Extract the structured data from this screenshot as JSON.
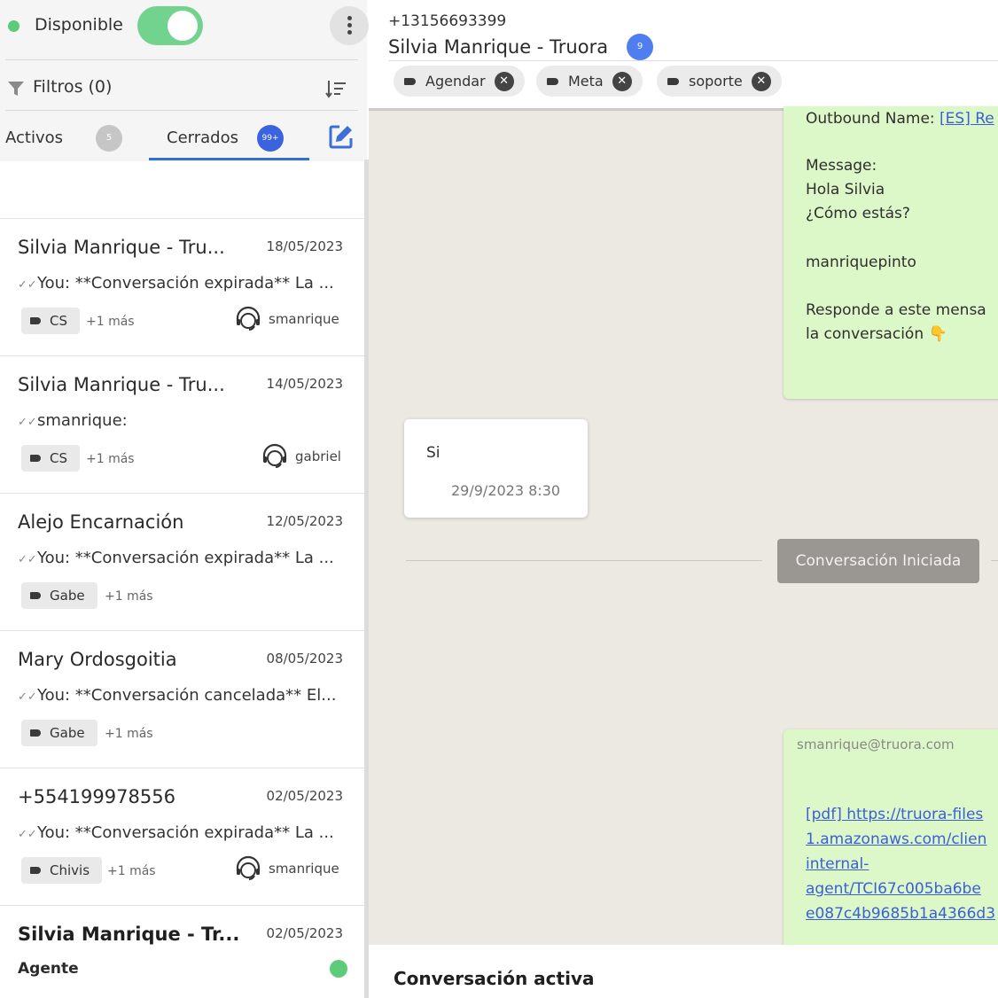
{
  "status": {
    "label": "Disponible",
    "toggle_on": true,
    "color": "#5ccc7a"
  },
  "filters": {
    "label": "Filtros (0)"
  },
  "tabs": {
    "activos": {
      "label": "Activos",
      "badge": "5"
    },
    "cerrados": {
      "label": "Cerrados",
      "badge": "99+"
    }
  },
  "conversations": [
    {
      "name": "Silvia Manrique - Tru...",
      "date": "18/05/2023",
      "preview": "You: **Conversación expirada** La ...",
      "tag": "CS",
      "more": "+1 más",
      "agent": "smanrique"
    },
    {
      "name": "Silvia Manrique - Tru...",
      "date": "14/05/2023",
      "preview": "smanrique:",
      "tag": "CS",
      "more": "+1 más",
      "agent": "gabriel"
    },
    {
      "name": "Alejo Encarnación",
      "date": "12/05/2023",
      "preview": "You: **Conversación expirada** La ...",
      "tag": "Gabe",
      "more": "+1 más"
    },
    {
      "name": "Mary Ordosgoitia",
      "date": "08/05/2023",
      "preview": "You: **Conversación cancelada** El...",
      "tag": "Gabe",
      "more": "+1 más"
    },
    {
      "name": "+554199978556",
      "date": "02/05/2023",
      "preview": "You: **Conversación expirada** La ...",
      "tag": "Chivis",
      "more": "+1 más",
      "agent": "smanrique"
    },
    {
      "name": "Silvia Manrique - Tr...",
      "date": "02/05/2023",
      "subtitle": "Agente",
      "online": true
    }
  ],
  "chat": {
    "phone": "+13156693399",
    "contact": "Silvia Manrique - Truora",
    "badge": "9",
    "tags": [
      "Agendar",
      "Meta",
      "soporte"
    ],
    "outbound": {
      "name_label": "Outbound Name:",
      "name_link": "[ES] Re",
      "lines": [
        "Message:",
        "Hola Silvia",
        "¿Cómo estás?",
        "",
        "manriquepinto",
        "",
        "Responde a este mensa",
        "la conversación 👇"
      ]
    },
    "incoming": {
      "text": "Si",
      "time": "29/9/2023 8:30"
    },
    "divider_label": "Conversación Iniciada",
    "file_message": {
      "sender": "smanrique@truora.com",
      "link_lines": [
        "[pdf] https://truora-files",
        "1.amazonaws.com/clien",
        "internal-",
        "agent/TCI67c005ba6be",
        "e087c4b9685b1a4366d3"
      ]
    },
    "footer_title": "Conversación activa"
  }
}
